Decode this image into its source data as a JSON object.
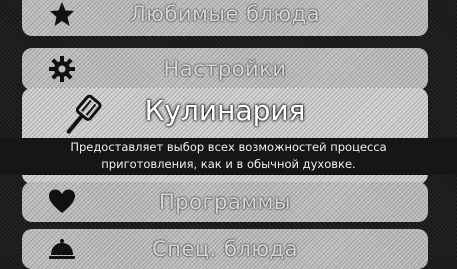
{
  "menu": {
    "items": [
      {
        "label": "Любимые блюда",
        "icon": "star-icon"
      },
      {
        "label": "Настройки",
        "icon": "gear-icon"
      },
      {
        "label": "Программы",
        "icon": "heart-icon"
      },
      {
        "label": "Спец. блюда",
        "icon": "cloche-icon"
      }
    ],
    "active": {
      "label": "Кулинария",
      "icon": "spatula-icon",
      "description_line1": "Предоставляет выбор всех возможностей процесса",
      "description_line2": "приготовления, как и в обычной духовке."
    }
  },
  "colors": {
    "background": "#1c1c1c",
    "item": "#bdbdbd",
    "active_item": "#d0d0d0",
    "description_bar": "#161616",
    "icon": "#111111"
  }
}
